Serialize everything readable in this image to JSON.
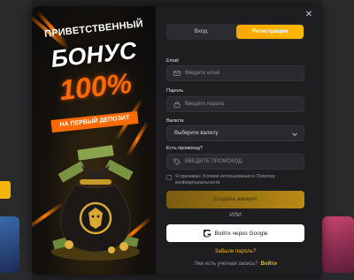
{
  "colors": {
    "accent": "#ffb800",
    "promo_orange": "#ff6a00",
    "modal_bg": "#1e1e21",
    "field_bg": "#2a2a2e"
  },
  "promo": {
    "line1": "ПРИВЕТСТВЕННЫЙ",
    "line2": "БОНУС",
    "line3": "100%",
    "line4": "НА ПЕРВЫЙ ДЕПОЗИТ",
    "image": "money-bag-illustration"
  },
  "modal": {
    "close_icon": "close-icon"
  },
  "tabs": [
    {
      "label": "Вход",
      "active": false
    },
    {
      "label": "Регистрация",
      "active": true
    }
  ],
  "form": {
    "email_label": "Email",
    "email_placeholder": "Введите email",
    "email_icon": "mail-icon",
    "password_label": "Пароль",
    "password_placeholder": "Введите пароль",
    "password_icon": "lock-icon",
    "currency_label": "Валюта",
    "currency_value": "Выберите валюту",
    "currency_icon": "chevron-down-icon",
    "promo_label": "Есть промокод?",
    "promo_placeholder": "ВВЕДИТЕ ПРОМОКОД",
    "promo_icon": "tag-icon",
    "terms_text": "Я принимаю Условия использования и Политику конфиденциальности",
    "terms_checked": false,
    "create_button": "Создать аккаунт",
    "or_text": "ИЛИ",
    "google_button": "Войти через Google",
    "forgot_link": "Забыли пароль?",
    "have_account": "Уже есть учетная запись?",
    "login_link": "Войти"
  }
}
